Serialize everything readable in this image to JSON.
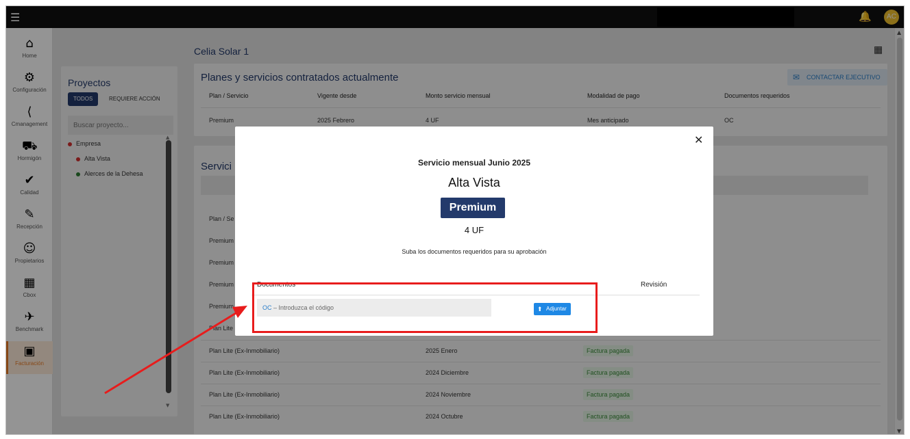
{
  "topbar": {
    "menu_icon": "☰",
    "avatar_initials": "AC",
    "accent": "#f2c12e"
  },
  "sidebar": {
    "items": [
      {
        "label": "Home",
        "icon": "⌂"
      },
      {
        "label": "Configuración",
        "icon": "⚙"
      },
      {
        "label": "Cmanagement",
        "icon": "⟨"
      },
      {
        "label": "Hormigón",
        "icon": "⛟"
      },
      {
        "label": "Calidad",
        "icon": "✔"
      },
      {
        "label": "Recepción",
        "icon": "✎"
      },
      {
        "label": "Propietarios",
        "icon": "☺"
      },
      {
        "label": "Cbox",
        "icon": "▦"
      },
      {
        "label": "Benchmark",
        "icon": "✈"
      },
      {
        "label": "Facturación",
        "icon": "▣"
      }
    ],
    "active_index": 9
  },
  "projects": {
    "title": "Proyectos",
    "chips": [
      "TODOS",
      "REQUIERE ACCIÓN"
    ],
    "search_placeholder": "Buscar proyecto...",
    "items": [
      {
        "label": "Empresa",
        "color": "#d32f2f"
      },
      {
        "label": "Alta Vista",
        "color": "#d32f2f"
      },
      {
        "label": "Alerces de la Dehesa",
        "color": "#2e7d32"
      }
    ]
  },
  "page": {
    "title": "Celia Solar 1"
  },
  "plans": {
    "title": "Planes y servicios contratados actualmente",
    "contact_label": "CONTACTAR EJECUTIVO",
    "headers": [
      "Plan / Servicio",
      "Vigente desde",
      "Monto servicio mensual",
      "Modalidad de pago",
      "Documentos requeridos"
    ],
    "row": [
      "Premium",
      "2025 Febrero",
      "4 UF",
      "Mes anticipado",
      "OC"
    ]
  },
  "services": {
    "title_visible": "Servici",
    "header_visible": "Plan / Se",
    "rows": [
      {
        "plan": "Premium",
        "period": "",
        "status": ""
      },
      {
        "plan": "Premium",
        "period": "",
        "status": ""
      },
      {
        "plan": "Premium",
        "period": "",
        "status": ""
      },
      {
        "plan": "Premium",
        "period": "",
        "status": ""
      },
      {
        "plan": "Plan Lite",
        "period": "",
        "status": ""
      },
      {
        "plan": "Plan Lite (Ex-Inmobiliario)",
        "period": "2025 Enero",
        "status": "Factura pagada"
      },
      {
        "plan": "Plan Lite (Ex-Inmobiliario)",
        "period": "2024 Diciembre",
        "status": "Factura pagada"
      },
      {
        "plan": "Plan Lite (Ex-Inmobiliario)",
        "period": "2024 Noviembre",
        "status": "Factura pagada"
      },
      {
        "plan": "Plan Lite (Ex-Inmobiliario)",
        "period": "2024 Octubre",
        "status": "Factura pagada"
      }
    ]
  },
  "modal": {
    "close_icon": "✕",
    "subtitle": "Servicio mensual Junio 2025",
    "project": "Alta Vista",
    "plan": "Premium",
    "amount": "4 UF",
    "instruction": "Suba los documentos requeridos para su aprobación",
    "doc_header": "Documentos",
    "review_header": "Revisión",
    "doc_code": "OC",
    "doc_placeholder": "Introduzca el código",
    "attach_label": "Adjuntar"
  },
  "annotation": {
    "highlight_color": "#e81c1c"
  }
}
